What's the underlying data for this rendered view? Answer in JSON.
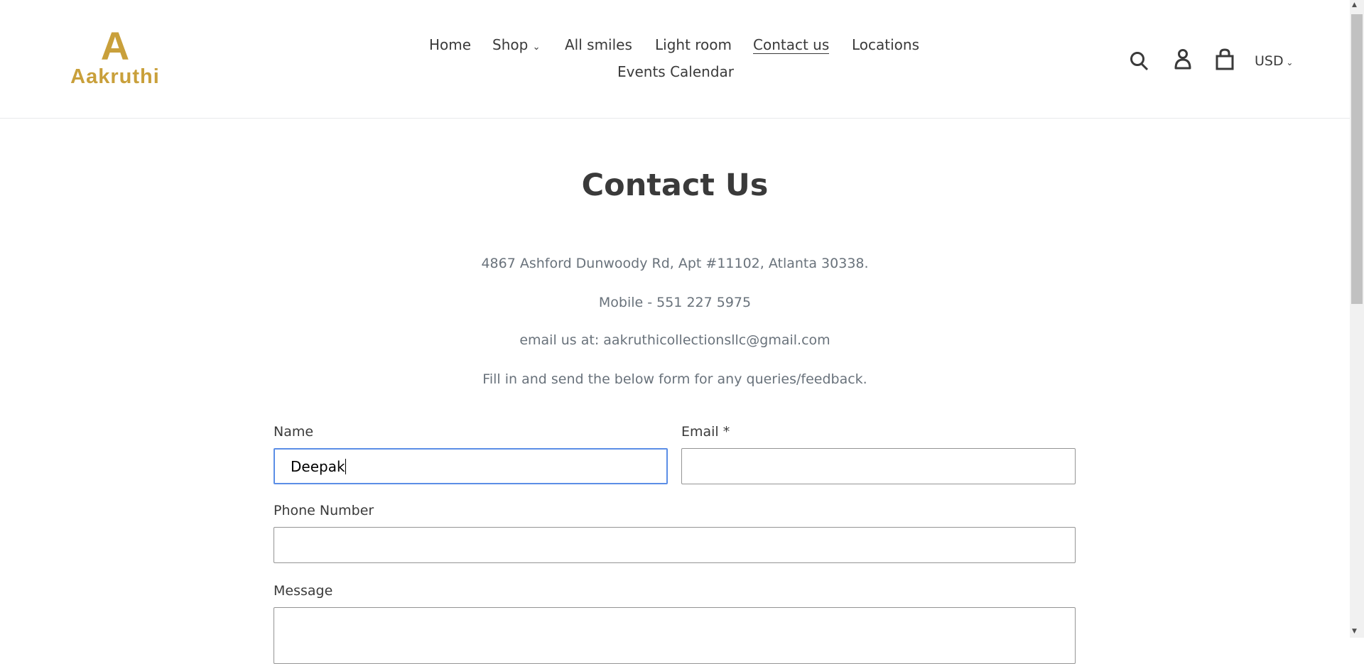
{
  "brand": {
    "name": "Aakruthi",
    "logo_letter": "A",
    "color": "#c9a03b"
  },
  "nav": {
    "items": [
      "Home",
      "Shop",
      "All smiles",
      "Light room",
      "Contact us",
      "Locations",
      "Events Calendar"
    ],
    "active": "Contact us"
  },
  "header_actions": {
    "currency": "USD"
  },
  "page": {
    "title": "Contact Us",
    "address": "4867 Ashford Dunwoody Rd, Apt #11102, Atlanta 30338.",
    "mobile": "Mobile - 551 227 5975",
    "email": "email us at: aakruthicollectionsllc@gmail.com",
    "instruction": "Fill in and send the below form for any queries/feedback."
  },
  "form": {
    "name_label": "Name",
    "name_value": "Deepak",
    "email_label": "Email *",
    "email_value": "",
    "phone_label": "Phone Number",
    "phone_value": "",
    "message_label": "Message",
    "message_value": ""
  }
}
